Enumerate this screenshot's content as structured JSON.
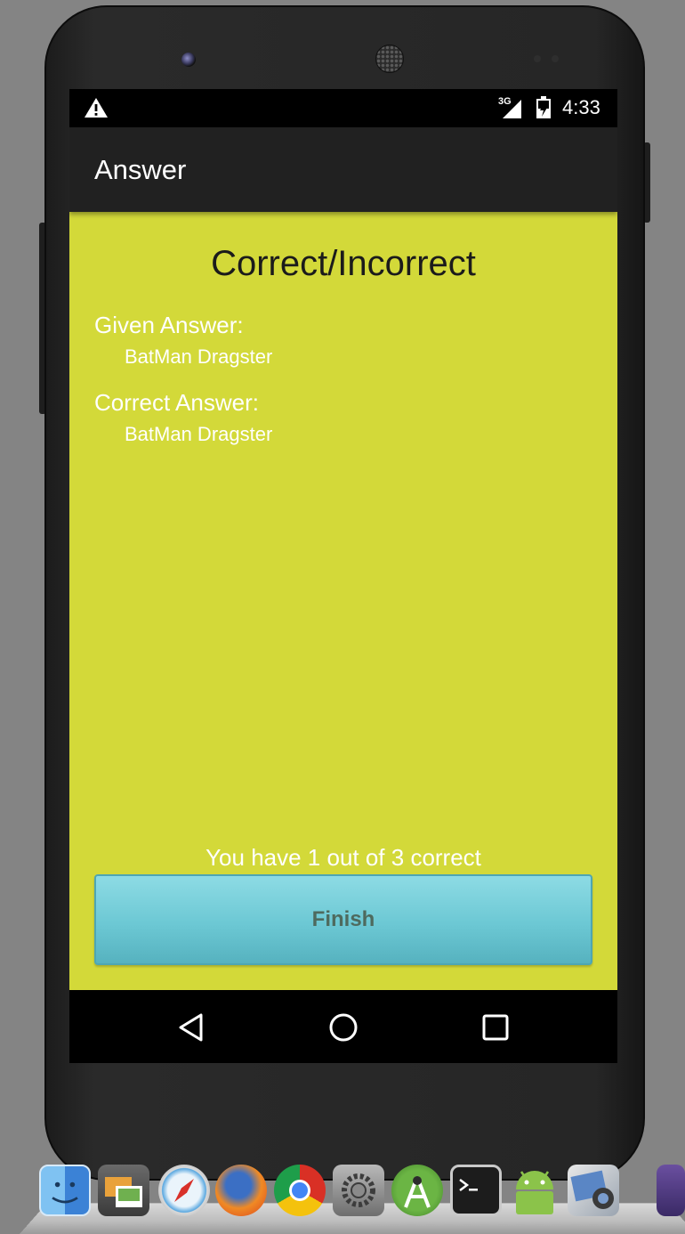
{
  "statusbar": {
    "alert_icon": "warning-triangle-icon",
    "network_label": "3G",
    "signal_icon": "cell-signal-icon",
    "battery_icon": "battery-charging-icon",
    "time": "4:33"
  },
  "appbar": {
    "title": "Answer"
  },
  "main": {
    "heading": "Correct/Incorrect",
    "given_label": "Given Answer:",
    "given_value": "BatMan Dragster",
    "correct_label": "Correct Answer:",
    "correct_value": "BatMan Dragster",
    "score_text": "You have 1 out of 3 correct",
    "finish_label": "Finish"
  },
  "navbar": {
    "back_icon": "back-triangle-icon",
    "home_icon": "home-circle-icon",
    "recents_icon": "recents-square-icon"
  },
  "dock": {
    "icons": [
      "finder-icon",
      "preview-icon",
      "safari-icon",
      "firefox-icon",
      "chrome-icon",
      "system-preferences-icon",
      "android-studio-icon",
      "terminal-icon",
      "android-icon",
      "image-capture-icon",
      "app-icon"
    ]
  },
  "colors": {
    "screen_background": "#d3d939",
    "appbar": "#212121",
    "button": "#6cc8d4",
    "desktop": "#848484"
  }
}
